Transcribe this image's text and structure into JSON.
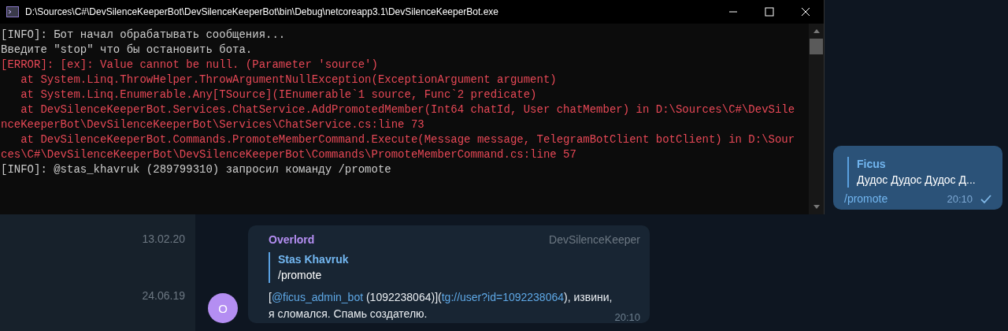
{
  "console": {
    "title": "D:\\Sources\\C#\\DevSilenceKeeperBot\\DevSilenceKeeperBot\\bin\\Debug\\netcoreapp3.1\\DevSilenceKeeperBot.exe",
    "lines": [
      {
        "kind": "info",
        "text": "[INFO]: Бот начал обрабатывать сообщения..."
      },
      {
        "kind": "info",
        "text": "Введите \"stop\" что бы остановить бота."
      },
      {
        "kind": "error",
        "text": "[ERROR]: [ex]: Value cannot be null. (Parameter 'source')"
      },
      {
        "kind": "error",
        "text": "   at System.Linq.ThrowHelper.ThrowArgumentNullException(ExceptionArgument argument)"
      },
      {
        "kind": "error",
        "text": "   at System.Linq.Enumerable.Any[TSource](IEnumerable`1 source, Func`2 predicate)"
      },
      {
        "kind": "error",
        "text": "   at DevSilenceKeeperBot.Services.ChatService.AddPromotedMember(Int64 chatId, User chatMember) in D:\\Sources\\C#\\DevSile"
      },
      {
        "kind": "error",
        "text": "nceKeeperBot\\DevSilenceKeeperBot\\Services\\ChatService.cs:line 73"
      },
      {
        "kind": "error",
        "text": "   at DevSilenceKeeperBot.Commands.PromoteMemberCommand.Execute(Message message, TelegramBotClient botClient) in D:\\Sour"
      },
      {
        "kind": "error",
        "text": "ces\\C#\\DevSilenceKeeperBot\\DevSilenceKeeperBot\\Commands\\PromoteMemberCommand.cs:line 57"
      },
      {
        "kind": "info",
        "text": "[INFO]: @stas_khavruk (289799310) запросил команду /promote"
      }
    ]
  },
  "chat_list": {
    "dates": [
      "13.02.20",
      "24.06.19"
    ]
  },
  "outgoing": {
    "reply_author": "Ficus",
    "reply_text": "Дудос Дудос Дудос Д...",
    "text": "/promote",
    "time": "20:10",
    "read": true
  },
  "incoming": {
    "author": "Overlord",
    "chat": "DevSilenceKeeper",
    "avatar_letter": "O",
    "reply_author": "Stas Khavruk",
    "reply_text": "/promote",
    "body": [
      {
        "kind": "text",
        "text": "["
      },
      {
        "kind": "link",
        "text": "@ficus_admin_bot"
      },
      {
        "kind": "text",
        "text": " (1092238064)]("
      },
      {
        "kind": "link",
        "text": "tg://user?id=1092238064"
      },
      {
        "kind": "text",
        "text": "), извини, я сломался. Спамь создателю."
      }
    ],
    "time": "20:10"
  }
}
